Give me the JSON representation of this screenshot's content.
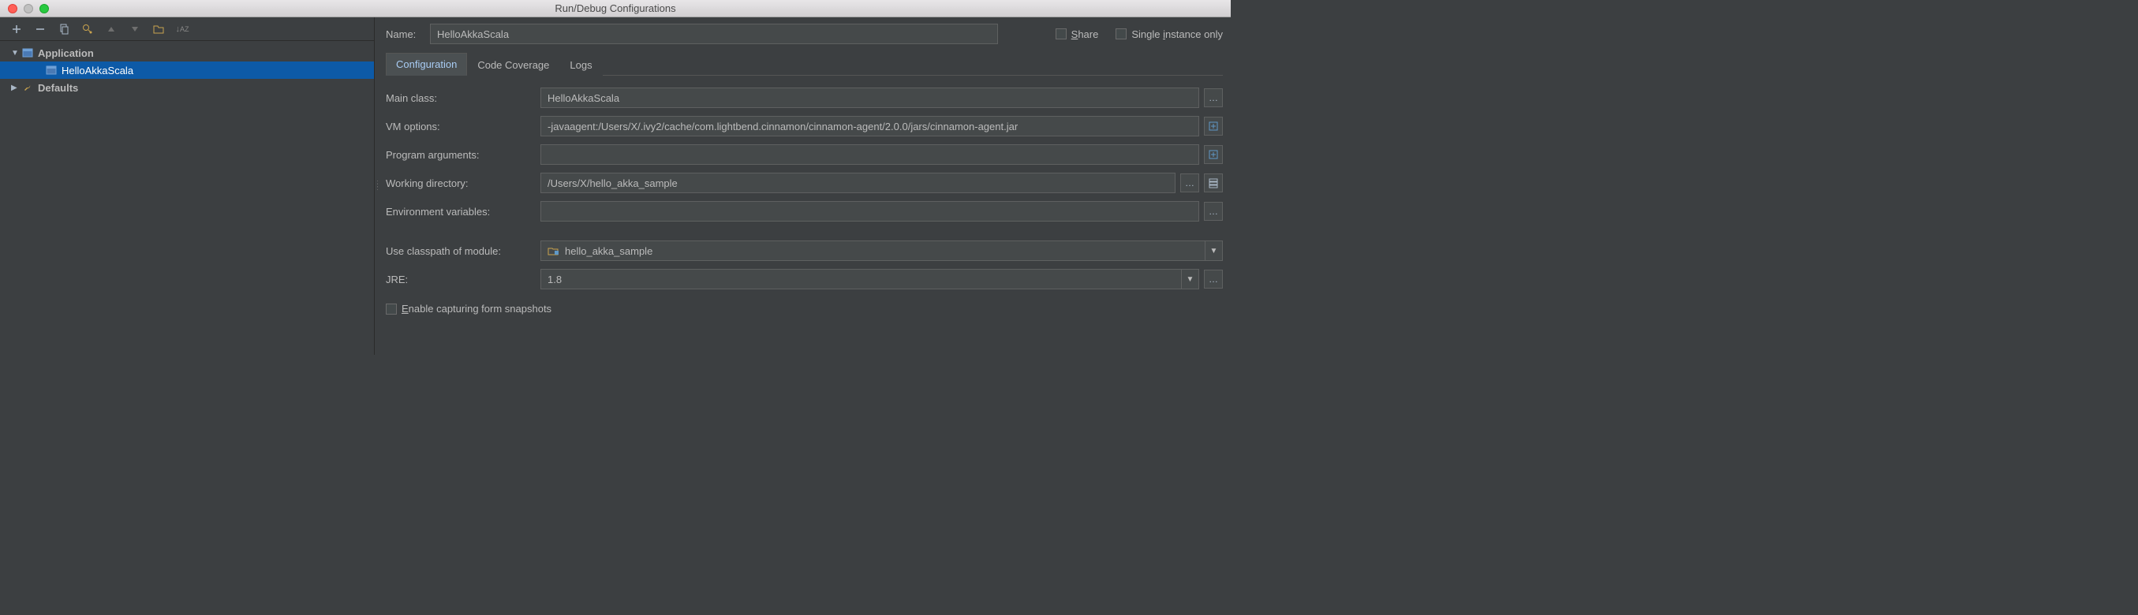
{
  "window": {
    "title": "Run/Debug Configurations"
  },
  "toolbar": {
    "add": "+",
    "remove": "−"
  },
  "tree": {
    "application_label": "Application",
    "helloakka_label": "HelloAkkaScala",
    "defaults_label": "Defaults"
  },
  "header": {
    "name_label": "Name:",
    "name_value": "HelloAkkaScala",
    "share_label": "Share",
    "single_instance_label": "Single instance only"
  },
  "tabs": {
    "configuration": "Configuration",
    "code_coverage": "Code Coverage",
    "logs": "Logs"
  },
  "form": {
    "main_class_label": "Main class:",
    "main_class_value": "HelloAkkaScala",
    "vm_options_label": "VM options:",
    "vm_options_value": "-javaagent:/Users/X/.ivy2/cache/com.lightbend.cinnamon/cinnamon-agent/2.0.0/jars/cinnamon-agent.jar",
    "program_args_label": "Program arguments:",
    "program_args_value": "",
    "working_dir_label": "Working directory:",
    "working_dir_value": "/Users/X/hello_akka_sample",
    "env_vars_label": "Environment variables:",
    "env_vars_value": "",
    "classpath_label": "Use classpath of module:",
    "classpath_value": "hello_akka_sample",
    "jre_label": "JRE:",
    "jre_value": "1.8",
    "enable_snapshots_label": "Enable capturing form snapshots"
  }
}
